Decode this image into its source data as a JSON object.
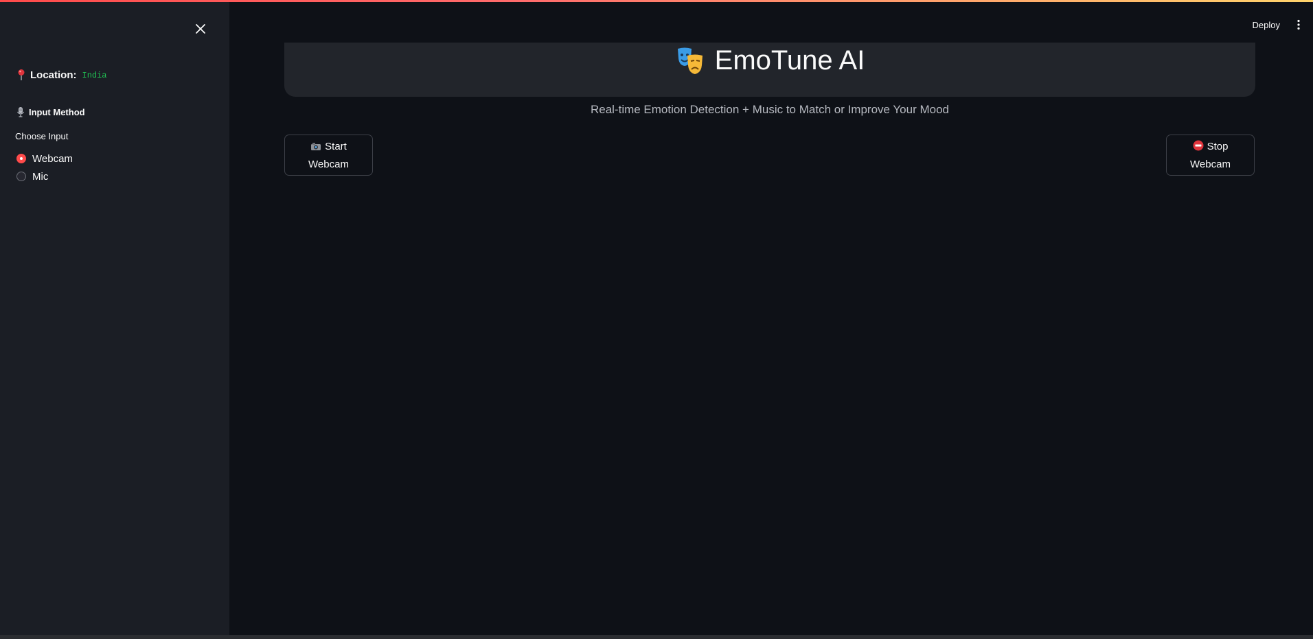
{
  "sidebar": {
    "close_icon": "close-icon",
    "location": {
      "icon": "map-pin-icon",
      "label": "Location:",
      "value": "India"
    },
    "input_method": {
      "icon": "microphone-icon",
      "heading": "Input Method"
    },
    "choose_input": {
      "label": "Choose Input",
      "options": [
        {
          "label": "Webcam",
          "selected": true
        },
        {
          "label": "Mic",
          "selected": false
        }
      ]
    }
  },
  "header": {
    "deploy_label": "Deploy",
    "menu_icon": "more-vertical-icon"
  },
  "main": {
    "title_icon": "performing-arts-masks-icon",
    "title": "EmoTune AI",
    "subtitle": "Real-time Emotion Detection + Music to Match or Improve Your Mood",
    "start_button": {
      "icon": "camera-icon",
      "line1": "Start",
      "line2": "Webcam"
    },
    "stop_button": {
      "icon": "no-entry-icon",
      "line1": "Stop",
      "line2": "Webcam"
    }
  },
  "colors": {
    "accent": "#ff4b4b",
    "sidebar_bg": "#1b1e25",
    "main_bg": "#0e1117",
    "location_value": "#21c354"
  }
}
